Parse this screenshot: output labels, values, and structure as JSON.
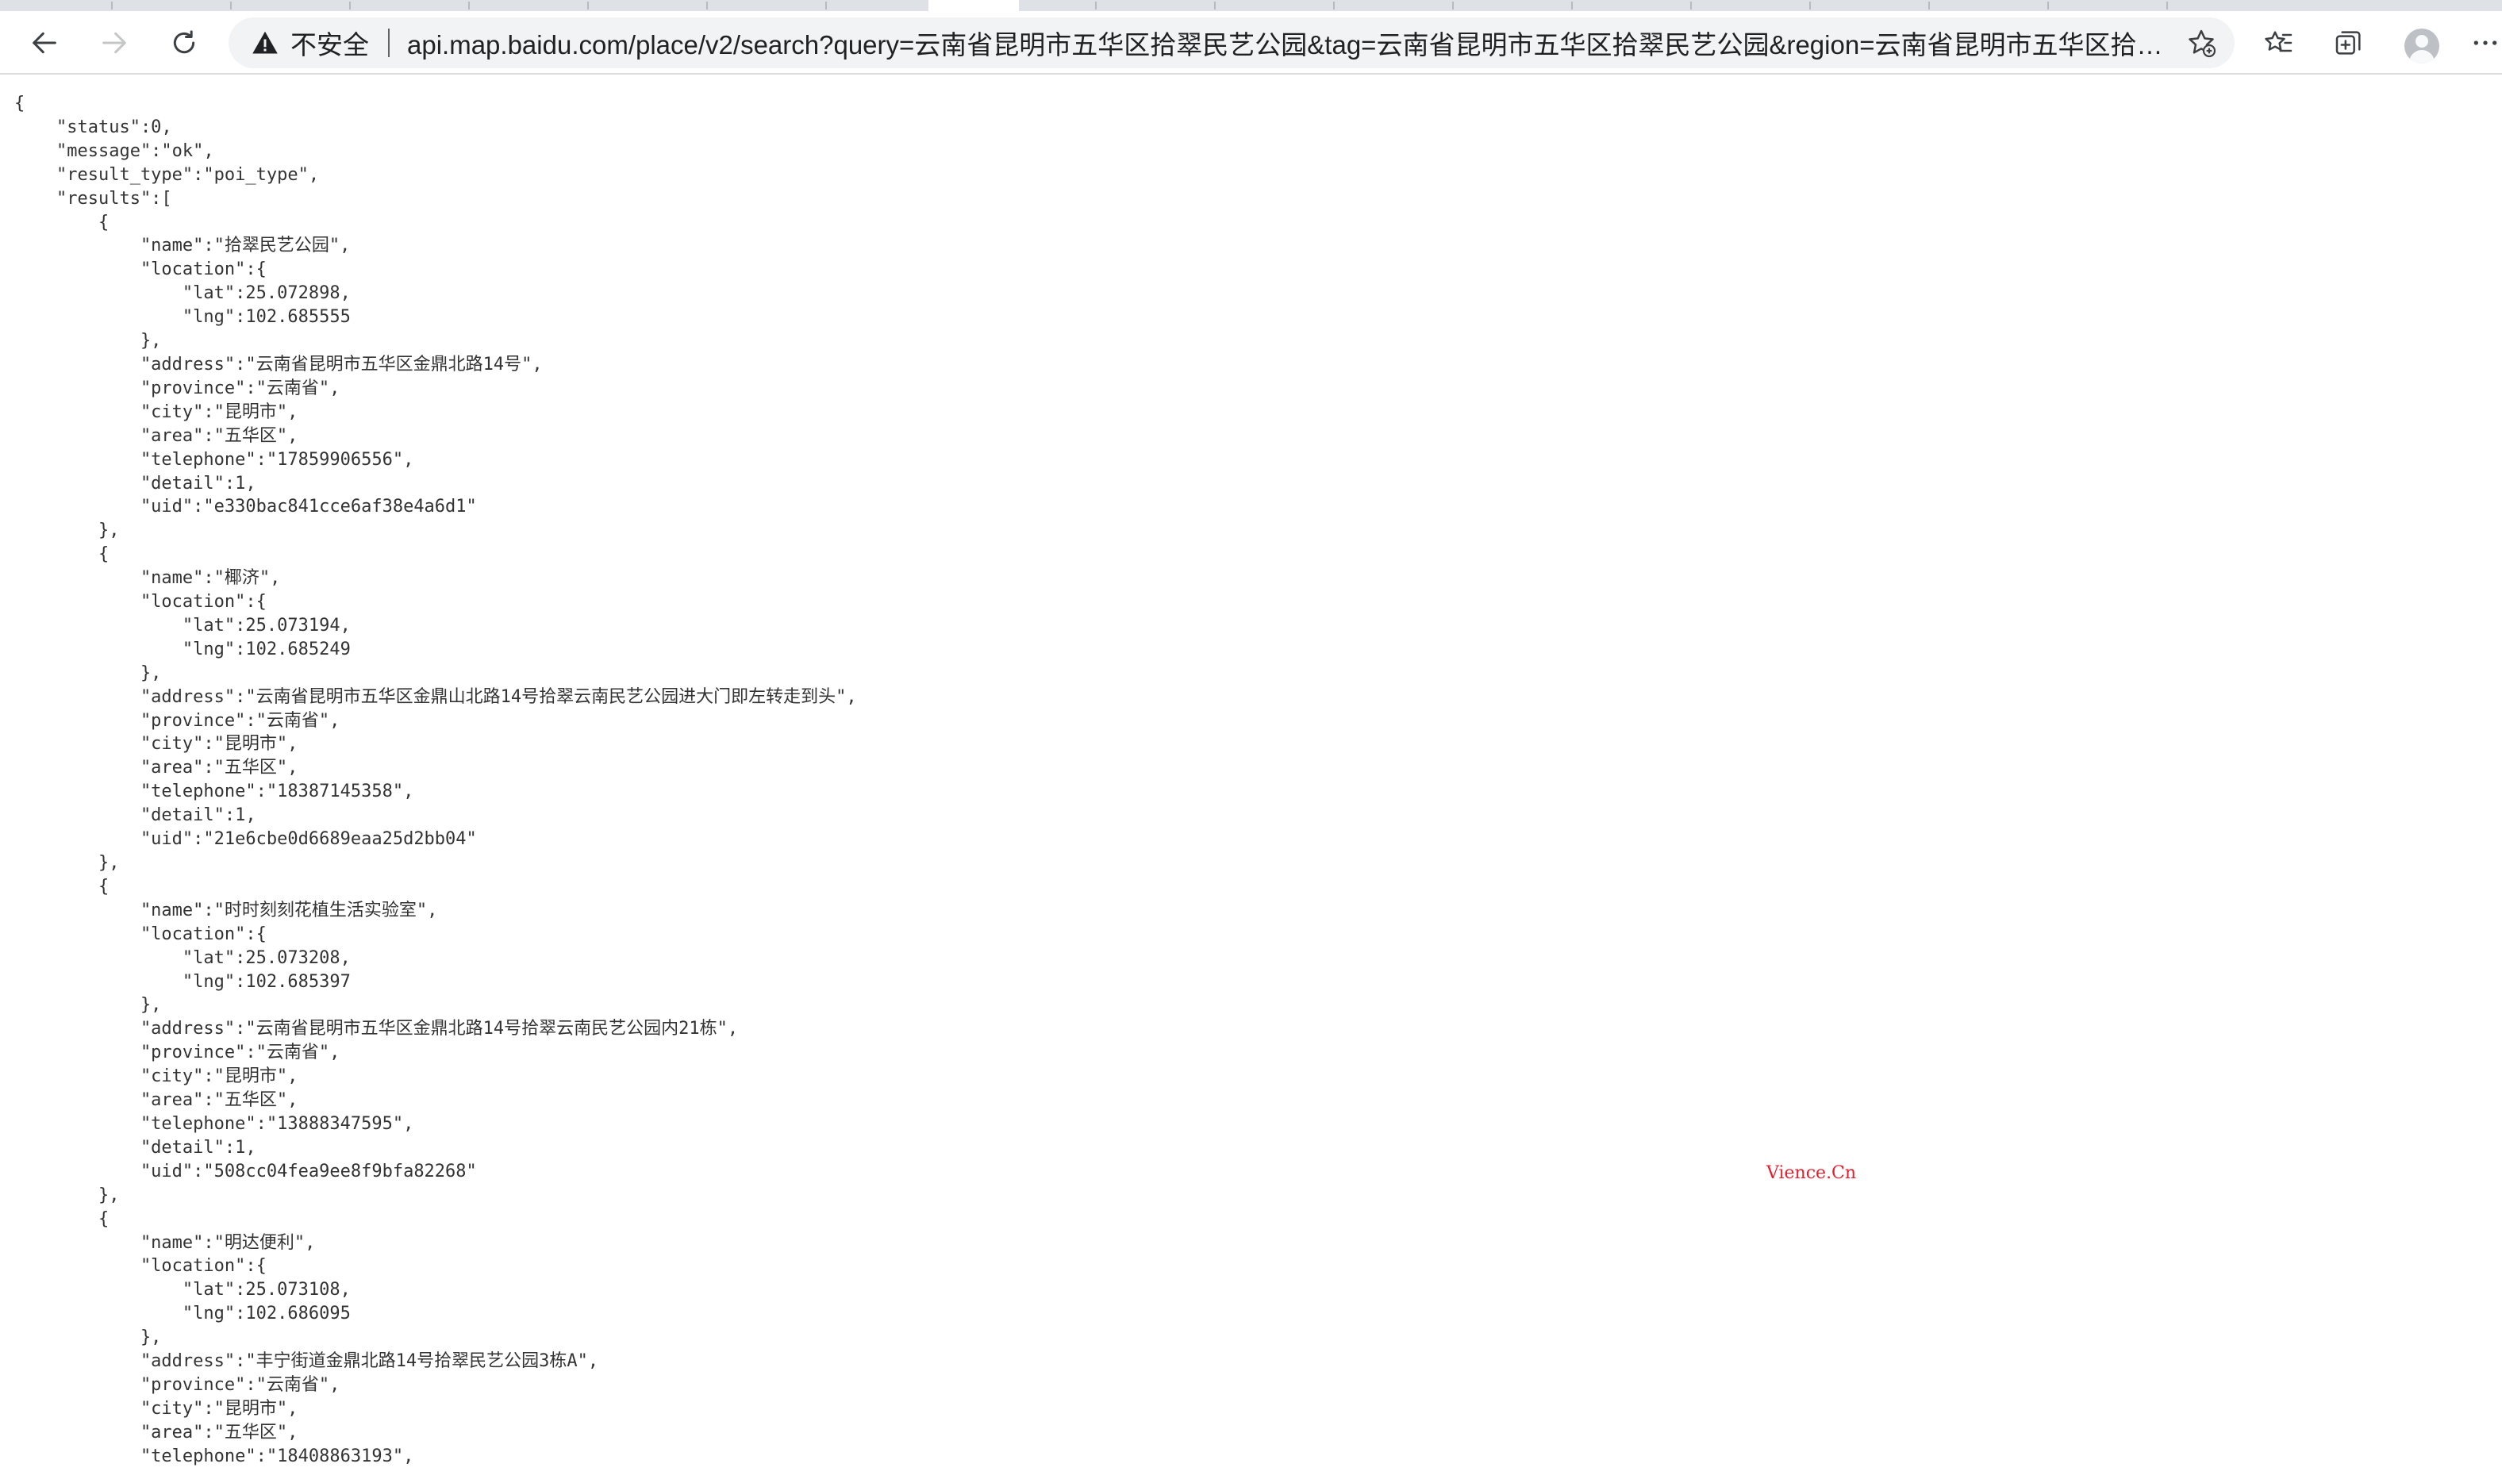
{
  "browser": {
    "security_label": "不安全",
    "url": "api.map.baidu.com/place/v2/search?query=云南省昆明市五华区拾翠民艺公园&tag=云南省昆明市五华区拾翠民艺公园&region=云南省昆明市五华区拾翠民...",
    "icons": [
      "back-arrow-icon",
      "forward-arrow-icon",
      "reload-icon",
      "warning-icon",
      "add-favorite-icon",
      "favorites-icon",
      "collections-icon",
      "profile-icon",
      "more-icon"
    ]
  },
  "json_lines": [
    "{",
    "    \"status\":0,",
    "    \"message\":\"ok\",",
    "    \"result_type\":\"poi_type\",",
    "    \"results\":[",
    "        {",
    "            \"name\":\"拾翠民艺公园\",",
    "            \"location\":{",
    "                \"lat\":25.072898,",
    "                \"lng\":102.685555",
    "            },",
    "            \"address\":\"云南省昆明市五华区金鼎北路14号\",",
    "            \"province\":\"云南省\",",
    "            \"city\":\"昆明市\",",
    "            \"area\":\"五华区\",",
    "            \"telephone\":\"17859906556\",",
    "            \"detail\":1,",
    "            \"uid\":\"e330bac841cce6af38e4a6d1\"",
    "        },",
    "        {",
    "            \"name\":\"椰济\",",
    "            \"location\":{",
    "                \"lat\":25.073194,",
    "                \"lng\":102.685249",
    "            },",
    "            \"address\":\"云南省昆明市五华区金鼎山北路14号拾翠云南民艺公园进大门即左转走到头\",",
    "            \"province\":\"云南省\",",
    "            \"city\":\"昆明市\",",
    "            \"area\":\"五华区\",",
    "            \"telephone\":\"18387145358\",",
    "            \"detail\":1,",
    "            \"uid\":\"21e6cbe0d6689eaa25d2bb04\"",
    "        },",
    "        {",
    "            \"name\":\"时时刻刻花植生活实验室\",",
    "            \"location\":{",
    "                \"lat\":25.073208,",
    "                \"lng\":102.685397",
    "            },",
    "            \"address\":\"云南省昆明市五华区金鼎北路14号拾翠云南民艺公园内21栋\",",
    "            \"province\":\"云南省\",",
    "            \"city\":\"昆明市\",",
    "            \"area\":\"五华区\",",
    "            \"telephone\":\"13888347595\",",
    "            \"detail\":1,",
    "            \"uid\":\"508cc04fea9ee8f9bfa82268\"",
    "        },",
    "        {",
    "            \"name\":\"明达便利\",",
    "            \"location\":{",
    "                \"lat\":25.073108,",
    "                \"lng\":102.686095",
    "            },",
    "            \"address\":\"丰宁街道金鼎北路14号拾翠民艺公园3栋A\",",
    "            \"province\":\"云南省\",",
    "            \"city\":\"昆明市\",",
    "            \"area\":\"五华区\",",
    "            \"telephone\":\"18408863193\","
  ],
  "watermark": "Vience.Cn"
}
